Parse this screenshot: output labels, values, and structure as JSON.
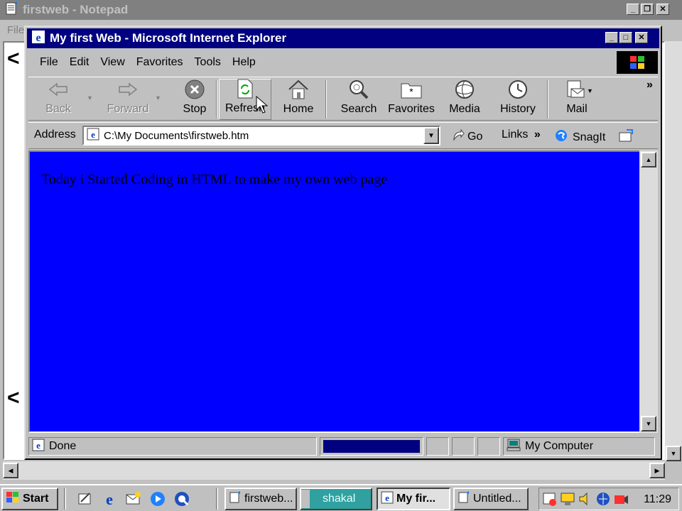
{
  "notepad": {
    "title": "firstweb - Notepad",
    "menu_file": "File",
    "chevron_top": "<",
    "chevron_bottom": "<",
    "controls": {
      "minimize": "_",
      "maximize": "❐",
      "close": "✕"
    }
  },
  "ie": {
    "title": "My first Web - Microsoft Internet Explorer",
    "controls": {
      "minimize": "_",
      "maximize": "□",
      "close": "✕"
    },
    "menu": [
      "File",
      "Edit",
      "View",
      "Favorites",
      "Tools",
      "Help"
    ],
    "toolbar": {
      "back": "Back",
      "forward": "Forward",
      "stop": "Stop",
      "refresh": "Refresh",
      "home": "Home",
      "search": "Search",
      "favorites": "Favorites",
      "media": "Media",
      "history": "History",
      "mail": "Mail",
      "more": "»"
    },
    "address": {
      "label": "Address",
      "value": "C:\\My Documents\\firstweb.htm",
      "go": "Go",
      "links": "Links",
      "links_more": "»",
      "snagit": "SnagIt"
    },
    "content": {
      "text": "Today i Started Coding in HTML to make my own web page",
      "background": "#0000ff"
    },
    "status": {
      "text": "Done",
      "zone": "My Computer"
    }
  },
  "taskbar": {
    "start": "Start",
    "tasks": [
      "firstweb...",
      "shakal",
      "My fir...",
      "Untitled..."
    ],
    "clock": "11:29"
  },
  "colors": {
    "titlebar_active": "#000080",
    "titlebar_inactive": "#808080",
    "face": "#c0c0c0",
    "content_bg": "#0000ff"
  }
}
